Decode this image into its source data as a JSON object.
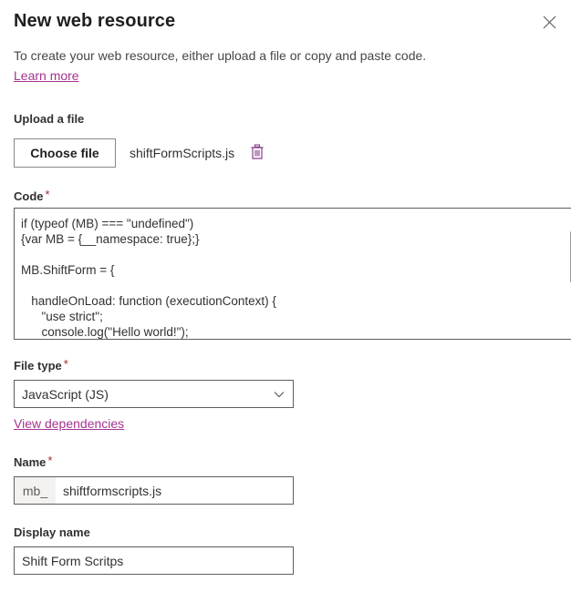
{
  "header": {
    "title": "New web resource",
    "subtitle": "To create your web resource, either upload a file or copy and paste code.",
    "learn_more_label": "Learn more",
    "close_icon": "close-icon"
  },
  "upload": {
    "label": "Upload a file",
    "choose_file_label": "Choose file",
    "file_name": "shiftFormScripts.js",
    "delete_icon": "trash-icon"
  },
  "code": {
    "label": "Code",
    "required_marker": "*",
    "value": "if (typeof (MB) === \"undefined\")\n{var MB = {__namespace: true};}\n\nMB.ShiftForm = {\n\n   handleOnLoad: function (executionContext) {\n      \"use strict\";\n      console.log(\"Hello world!\");",
    "scroll_up_icon": "caret-up-icon",
    "scroll_down_icon": "caret-down-icon"
  },
  "file_type": {
    "label": "File type",
    "required_marker": "*",
    "selected": "JavaScript (JS)",
    "chevron_icon": "chevron-down-icon",
    "view_dependencies_label": "View dependencies"
  },
  "name": {
    "label": "Name",
    "required_marker": "*",
    "prefix": "mb_",
    "value": "shiftformscripts.js",
    "placeholder": ""
  },
  "display_name": {
    "label": "Display name",
    "value": "Shift Form Scritps",
    "placeholder": ""
  },
  "colors": {
    "link": "#a4348f",
    "required": "#a4262c",
    "text": "#323130",
    "border": "#605e5c",
    "trash": "#8a3f8f"
  }
}
